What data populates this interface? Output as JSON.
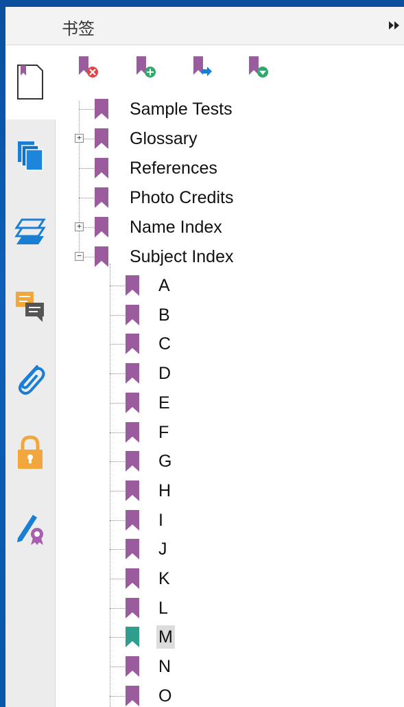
{
  "panel": {
    "title": "书签",
    "collapse_icon": "double-chevron-right-icon"
  },
  "side_rail": {
    "items": [
      {
        "name": "page-thumbnail-icon",
        "active": true
      },
      {
        "name": "copies-icon"
      },
      {
        "name": "layers-icon"
      },
      {
        "name": "comments-icon"
      },
      {
        "name": "attachment-icon"
      },
      {
        "name": "security-lock-icon"
      },
      {
        "name": "signature-icon"
      }
    ]
  },
  "toolbar": {
    "buttons": [
      {
        "name": "delete-bookmark-icon"
      },
      {
        "name": "add-bookmark-icon"
      },
      {
        "name": "move-bookmark-icon"
      },
      {
        "name": "expand-bookmark-icon"
      }
    ]
  },
  "tree": {
    "top_level": [
      {
        "label": "Sample Tests",
        "expander": ""
      },
      {
        "label": "Glossary",
        "expander": "+"
      },
      {
        "label": "References",
        "expander": ""
      },
      {
        "label": "Photo Credits",
        "expander": ""
      },
      {
        "label": "Name Index",
        "expander": "+"
      },
      {
        "label": "Subject Index",
        "expander": "−"
      }
    ],
    "subject_children": [
      "A",
      "B",
      "C",
      "D",
      "E",
      "F",
      "G",
      "H",
      "I",
      "J",
      "K",
      "L",
      "M",
      "N",
      "O"
    ],
    "selected_child": "M"
  },
  "colors": {
    "bookmark": "#9b5c9d",
    "bookmark_selected": "#2e9e8f",
    "selection_bg": "#dcdcdc"
  }
}
